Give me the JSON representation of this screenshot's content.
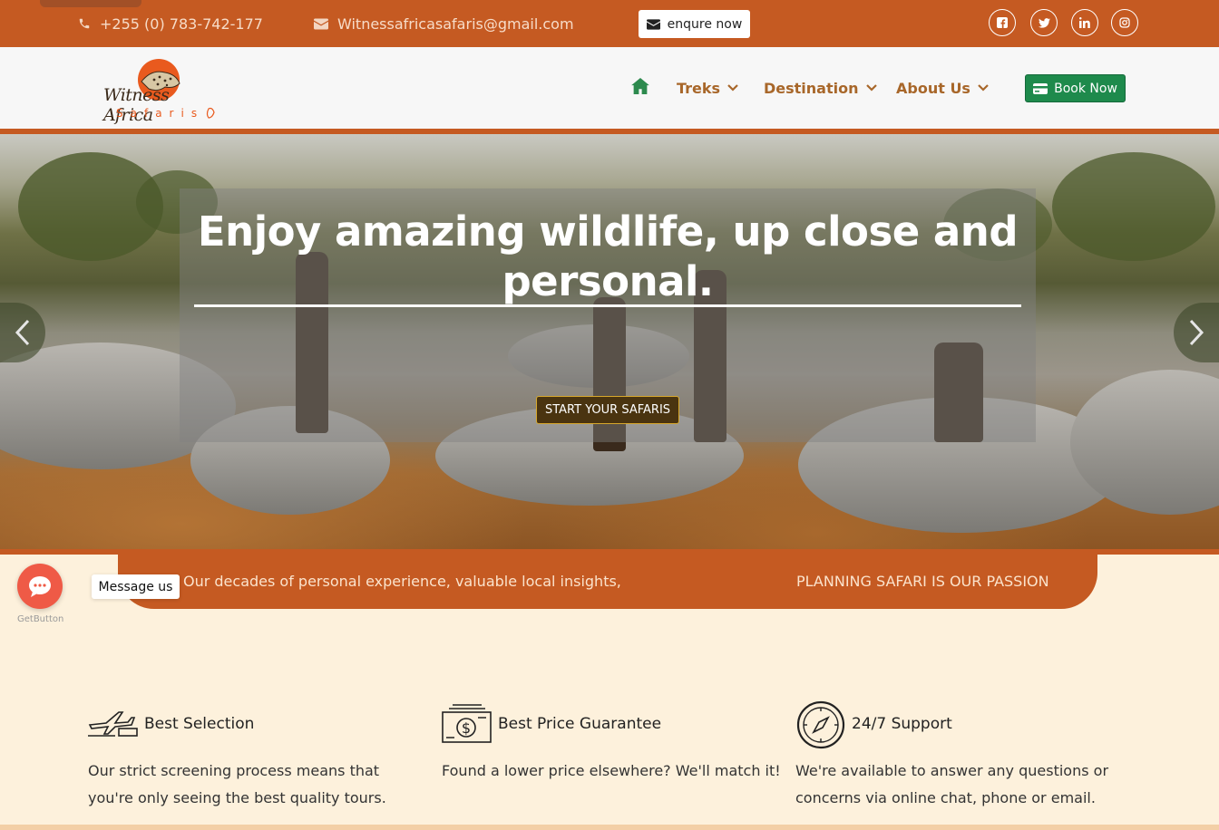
{
  "topbar": {
    "phone": "+255 (0) 783-742-177",
    "email": "Witnessafricasafaris@gmail.com",
    "enquire_label": "enqure now",
    "social": {
      "facebook": "f",
      "twitter": "t",
      "linkedin": "in",
      "instagram": "ig"
    }
  },
  "nav": {
    "logo_text_1": "Witness Africa",
    "logo_text_2": "Safaris",
    "items": [
      {
        "label": "Treks"
      },
      {
        "label": "Destination"
      },
      {
        "label": "About Us"
      }
    ],
    "book_now_label": "Book Now"
  },
  "hero": {
    "title_line1": "Enjoy amazing wildlife, up close and",
    "title_line2": "personal.",
    "cta_label": "START YOUR SAFARIS"
  },
  "banner": {
    "text_left": "Our decades of personal experience, valuable local insights,",
    "text_right": "PLANNING SAFARI IS OUR PASSION"
  },
  "chat": {
    "label": "Message us",
    "brand": "GetButton"
  },
  "features": [
    {
      "icon": "airplane-icon",
      "title": "Best Selection",
      "desc_line1": "Our strict screening process means that",
      "desc_line2": "you're only seeing the best quality tours."
    },
    {
      "icon": "money-icon",
      "title": "Best Price Guarantee",
      "desc_line1": "Found a lower price elsewhere? We'll match it!"
    },
    {
      "icon": "compass-icon",
      "title": "24/7 Support",
      "desc_line1": "We're available to answer any questions or",
      "desc_line2": "concerns via online chat, phone or email."
    }
  ],
  "colors": {
    "brand_orange": "#c55a22",
    "nav_text": "#a8672a",
    "book_green": "#1e8a4c",
    "page_bg": "#fdf1dc"
  }
}
